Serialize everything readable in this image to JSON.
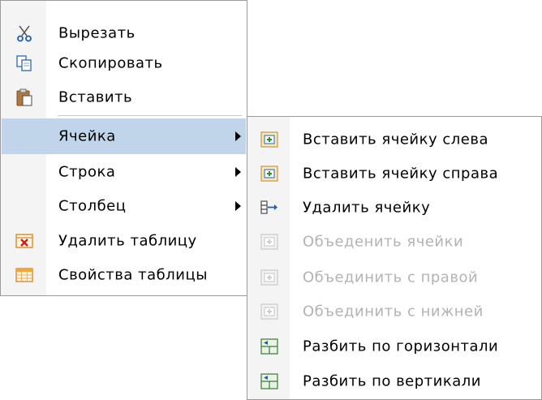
{
  "main_menu": {
    "items": [
      {
        "label": "Вырезать",
        "icon": "scissors-icon"
      },
      {
        "label": "Скопировать",
        "icon": "copy-icon"
      },
      {
        "label": "Вставить",
        "icon": "paste-icon"
      },
      {
        "label": "Ячейка",
        "submenu": true,
        "highlighted": true
      },
      {
        "label": "Строка",
        "submenu": true
      },
      {
        "label": "Столбец",
        "submenu": true
      },
      {
        "label": "Удалить таблицу",
        "icon": "delete-table-icon"
      },
      {
        "label": "Свойства таблицы",
        "icon": "table-properties-icon"
      }
    ]
  },
  "cell_submenu": {
    "items": [
      {
        "label": "Вставить ячейку слева",
        "icon": "insert-cell-icon",
        "enabled": true
      },
      {
        "label": "Вставить ячейку справа",
        "icon": "insert-cell-icon",
        "enabled": true
      },
      {
        "label": "Удалить ячейку",
        "icon": "delete-cell-icon",
        "enabled": true
      },
      {
        "label": "Объеденить ячейки",
        "icon": "merge-cells-icon",
        "enabled": false
      },
      {
        "label": "Объединить с правой",
        "icon": "merge-right-icon",
        "enabled": false
      },
      {
        "label": "Объединить с нижней",
        "icon": "merge-down-icon",
        "enabled": false
      },
      {
        "label": "Разбить по горизонтали",
        "icon": "split-horizontal-icon",
        "enabled": true
      },
      {
        "label": "Разбить по вертикали",
        "icon": "split-vertical-icon",
        "enabled": true
      }
    ]
  },
  "colors": {
    "highlight": "#c1d5ea",
    "gutter": "#f4f4f4",
    "disabled_text": "#b3b3b3",
    "border": "#9a9a9a"
  }
}
